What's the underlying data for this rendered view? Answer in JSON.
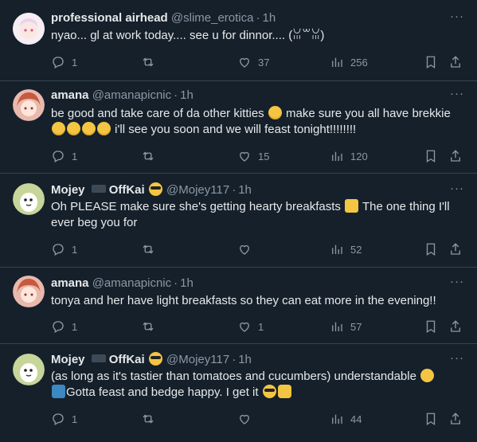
{
  "tweets": [
    {
      "name": "professional airhead",
      "handle": "@slime_erotica",
      "time": "1h",
      "text": "nyao... gl at work today.... see u for dinnor.... (ꈍ꒳ꈍ)",
      "replies": "1",
      "retweets": "",
      "likes": "37",
      "views": "256"
    },
    {
      "name": "amana",
      "handle": "@amanapicnic",
      "time": "1h",
      "text_a": "be good and take care of da other kitties",
      "text_b": "make sure you all have brekkie",
      "text_c": "i'll see you soon and we will feast tonight!!!!!!!!",
      "replies": "1",
      "retweets": "",
      "likes": "15",
      "views": "120"
    },
    {
      "name": "Mojey",
      "name_suffix": "OffKai",
      "handle": "@Mojey117",
      "time": "1h",
      "text_a": "Oh PLEASE make sure she's getting hearty breakfasts",
      "text_b": "The one thing I'll ever beg you for",
      "replies": "1",
      "retweets": "",
      "likes": "",
      "views": "52"
    },
    {
      "name": "amana",
      "handle": "@amanapicnic",
      "time": "1h",
      "text": "tonya and her have light breakfasts so they can eat more in the evening!!",
      "replies": "1",
      "retweets": "",
      "likes": "1",
      "views": "57"
    },
    {
      "name": "Mojey",
      "name_suffix": "OffKai",
      "handle": "@Mojey117",
      "time": "1h",
      "text_a": "(as long as it's tastier than tomatoes and cucumbers) understandable",
      "text_b": "Gotta feast and bedge happy. I get it",
      "replies": "1",
      "retweets": "",
      "likes": "",
      "views": "44"
    }
  ],
  "more_glyph": "···",
  "dot": "·",
  "colors": {
    "bg": "#15202b",
    "text": "#e7e9ea",
    "muted": "#8b98a5",
    "border": "#38444d"
  },
  "icons": [
    "reply-icon",
    "retweet-icon",
    "like-icon",
    "views-icon",
    "bookmark-icon",
    "share-icon"
  ]
}
